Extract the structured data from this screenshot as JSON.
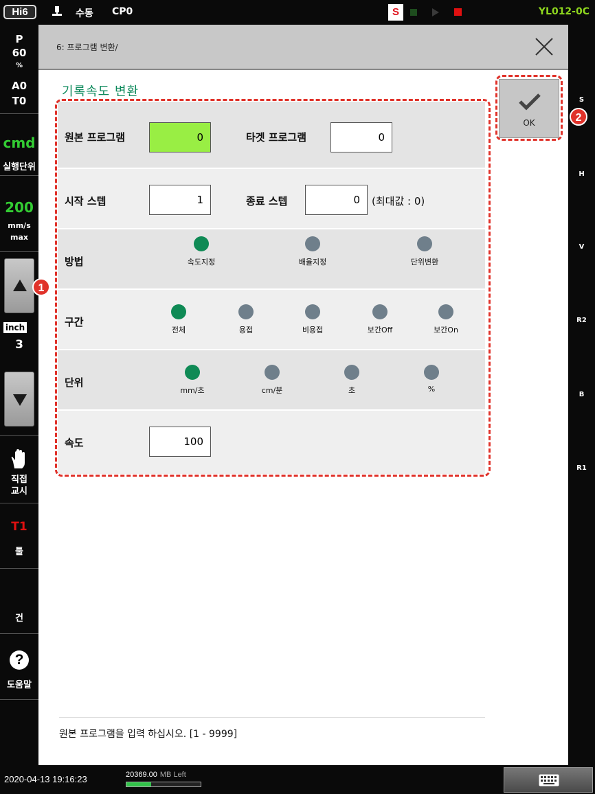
{
  "topbar": {
    "system": "Hi6",
    "mode": "수동",
    "program": "CP0",
    "s_badge": "S",
    "robot_id": "YL012-0C"
  },
  "leftbar": {
    "speed_pct_label": "P",
    "speed_pct": "60",
    "speed_pct_unit": "%",
    "a_value": "A0",
    "t_value": "T0",
    "cmd_label": "cmd",
    "cmd_sub": "실행단위",
    "speed": "200",
    "speed_unit": "mm/s",
    "speed_mode": "max",
    "inch_label": "inch",
    "inch_value": "3",
    "direct_teach_1": "직접",
    "direct_teach_2": "교시",
    "tool_label": "T1",
    "tool_sub": "툴",
    "gun_label": "건",
    "help_icon": "?",
    "help_label": "도움말"
  },
  "rightbar": {
    "items": [
      "S",
      "H",
      "V",
      "R2",
      "B",
      "R1"
    ]
  },
  "header": {
    "breadcrumb": "6: 프로그램 변환/"
  },
  "dialog": {
    "title": "기록속도 변환",
    "source_program_label": "원본 프로그램",
    "source_program_value": "0",
    "target_program_label": "타겟 프로그램",
    "target_program_value": "0",
    "start_step_label": "시작 스텝",
    "start_step_value": "1",
    "end_step_label": "종료 스텝",
    "end_step_value": "0",
    "max_note": "(최대값 : 0)",
    "method_label": "방법",
    "method_options": [
      "속도지정",
      "배율지정",
      "단위변환"
    ],
    "method_selected": 0,
    "section_label": "구간",
    "section_options": [
      "전체",
      "용접",
      "비용접",
      "보간Off",
      "보간On"
    ],
    "section_selected": 0,
    "unit_label": "단위",
    "unit_options": [
      "mm/초",
      "cm/분",
      "초",
      "%"
    ],
    "unit_selected": 0,
    "speed_label": "속도",
    "speed_value": "100",
    "ok_label": "OK",
    "hint": "원본 프로그램을 입력 하십시오. [1 - 9999]"
  },
  "callouts": [
    "1",
    "2"
  ],
  "bottombar": {
    "datetime": "2020-04-13 19:16:23",
    "memory_value": "20369.00",
    "memory_unit": "MB Left",
    "memory_used_fraction": 0.33
  },
  "colors": {
    "accent_green": "#0f8a55",
    "active_input": "#99ee44",
    "callout_red": "#e0322a",
    "robot_id": "#8ed61e"
  }
}
